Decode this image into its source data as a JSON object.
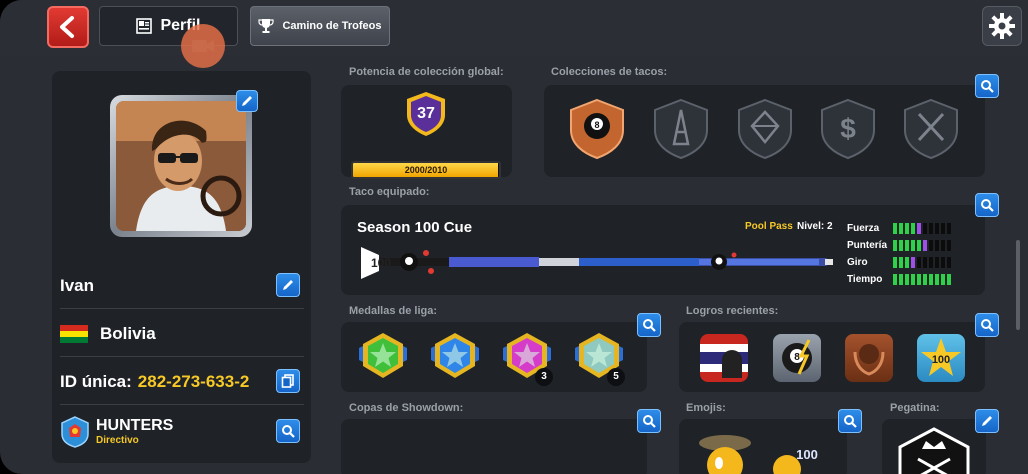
{
  "header": {
    "tabs": [
      {
        "label": "Perfil"
      },
      {
        "label": "Camino de Trofeos"
      }
    ]
  },
  "profile": {
    "name": "Ivan",
    "country": "Bolivia",
    "id_label": "ID única:",
    "id_value": "282-273-633-2",
    "club_name": "HUNTERS",
    "club_role": "Directivo"
  },
  "collection_power": {
    "label": "Potencia de colección global:",
    "level": "37",
    "progress_text": "2000/2010",
    "progress_fraction": 0.995
  },
  "cue_collections": {
    "label": "Colecciones de tacos:",
    "icons": [
      "8-ball-shield-icon",
      "eiffel-shield-icon",
      "diamond-shield-icon",
      "dollar-shield-icon",
      "swords-shield-icon"
    ]
  },
  "equipped_cue": {
    "label": "Taco equipado:",
    "name": "Season 100 Cue",
    "pool_pass": "Pool Pass",
    "level_text": "Nivel: 2",
    "stats": [
      {
        "label": "Fuerza",
        "green": 4,
        "purple": 1
      },
      {
        "label": "Puntería",
        "green": 5,
        "purple": 1
      },
      {
        "label": "Giro",
        "green": 3,
        "purple": 1
      },
      {
        "label": "Tiempo",
        "green": 10,
        "purple": 0
      }
    ]
  },
  "league_medals": {
    "label": "Medallas de liga:",
    "medals": [
      {
        "color": "#3fbf3a",
        "count": ""
      },
      {
        "color": "#2f86e8",
        "count": ""
      },
      {
        "color": "#d43cc9",
        "count": "3"
      },
      {
        "color": "#8fc9c0",
        "count": "5"
      }
    ]
  },
  "recent_achievements": {
    "label": "Logros recientes:"
  },
  "showdown": {
    "label": "Copas de Showdown:"
  },
  "emojis": {
    "label": "Emojis:"
  },
  "sticker": {
    "label": "Pegatina:"
  },
  "colors": {
    "accent_blue": "#1e78dc",
    "back_red": "#c8271f",
    "gold": "#f7c927"
  }
}
